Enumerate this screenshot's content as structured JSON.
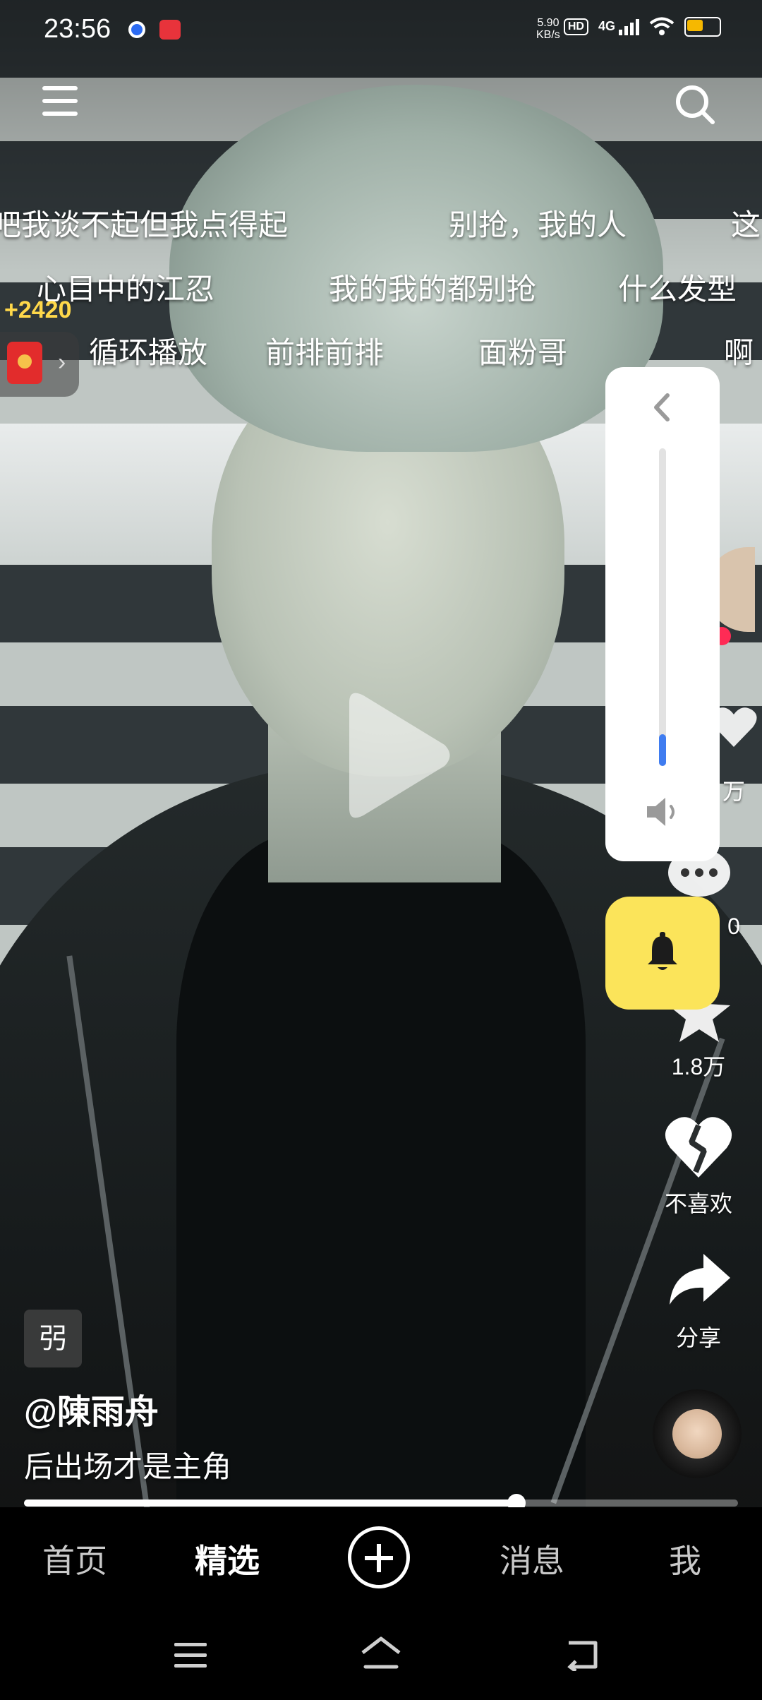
{
  "status_bar": {
    "time": "23:56",
    "net_speed_value": "5.90",
    "net_speed_unit": "KB/s",
    "hd": "HD",
    "network": "4G",
    "battery_color": "#f6b800"
  },
  "danmu": [
    "吧我谈不起但我点得起",
    "别抢，我的人",
    "这",
    "心目中的江忍",
    "我的我的都别抢",
    "什么发型",
    "循环播放",
    "前排前排",
    "面粉哥",
    "啊"
  ],
  "reward": {
    "amount": "+2420"
  },
  "right_actions": {
    "like_count": "万",
    "comment_count": "0",
    "favorite_count": "1.8万",
    "dislike_label": "不喜欢",
    "share_label": "分享"
  },
  "volume": {
    "level": 0.1
  },
  "video": {
    "author_tag": "弜",
    "author": "@陳雨舟",
    "description": "后出场才是主角",
    "progress": 0.69
  },
  "tabs": [
    {
      "label": "首页",
      "active": false
    },
    {
      "label": "精选",
      "active": true
    },
    {
      "label": "消息",
      "active": false
    },
    {
      "label": "我",
      "active": false
    }
  ],
  "colors": {
    "accent_yellow": "#fbe45a",
    "volume_blue": "#3f7cf0",
    "follow_red": "#ff2b55"
  }
}
